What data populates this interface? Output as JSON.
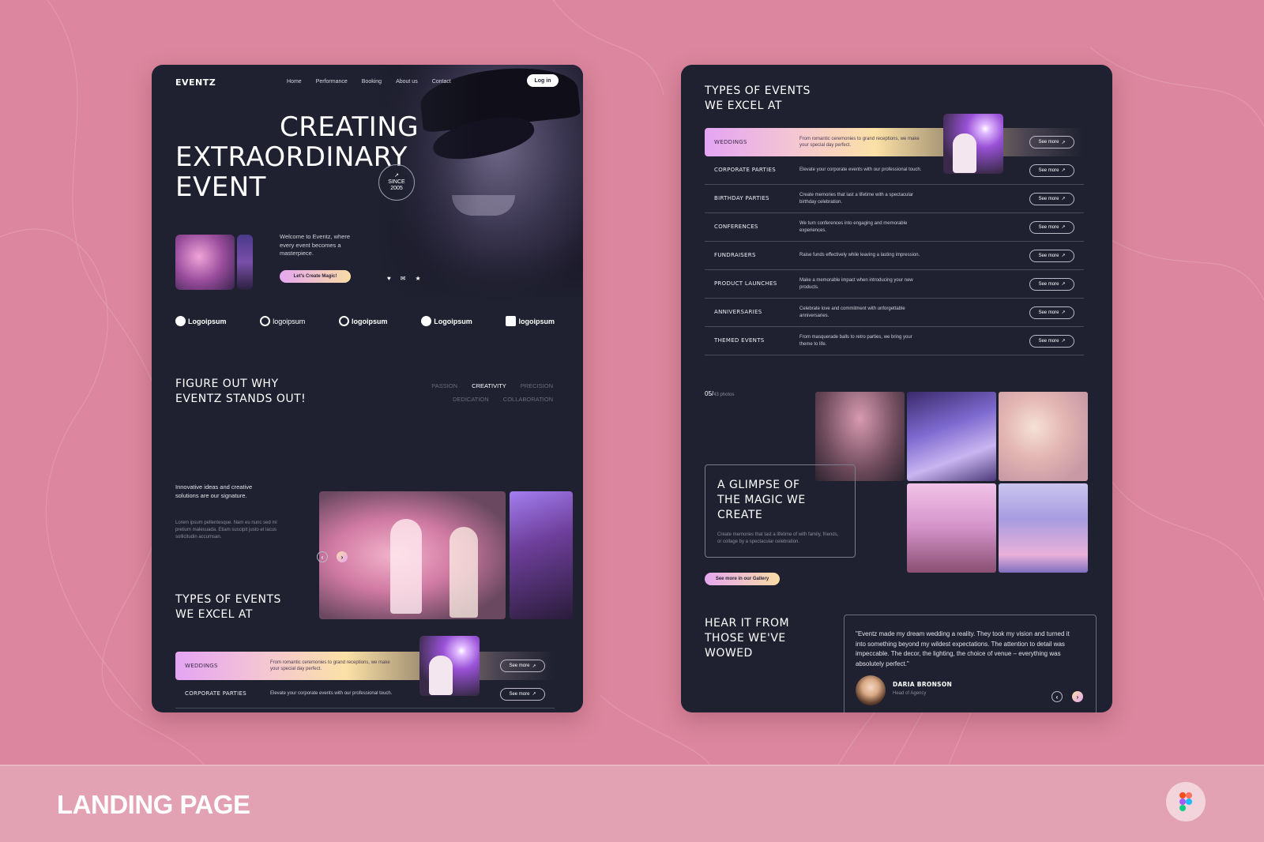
{
  "showcase": {
    "title": "LANDING PAGE",
    "tool_icon": "figma-icon",
    "background_color": "#dc879f"
  },
  "nav": {
    "logo": "EVENTZ",
    "links": [
      "Home",
      "Performance",
      "Booking",
      "About us",
      "Contact"
    ],
    "login_label": "Log in"
  },
  "hero": {
    "title_line1": "CREATING",
    "title_line2": "EXTRAORDINARY",
    "title_line3": "EVENT",
    "badge_line1": "SINCE",
    "badge_line2": "2005",
    "welcome_text": "Welcome to Eventz, where every event becomes a masterpiece.",
    "cta_label": "Let's Create Magic!",
    "social_icons": [
      "heart-icon",
      "mail-icon",
      "star-icon"
    ]
  },
  "partners": [
    "Logoipsum",
    "logoipsum",
    "logoipsum",
    "Logoipsum",
    "logoipsum"
  ],
  "why": {
    "title_line1": "FIGURE OUT WHY",
    "title_line2": "EVENTZ STANDS OUT!",
    "values_row1": [
      "PASSION",
      "CREATIVITY",
      "PRECISION"
    ],
    "values_row2": [
      "DEDICATION",
      "COLLABORATION"
    ],
    "active_value": "CREATIVITY",
    "lead": "Innovative ideas and creative solutions are our signature.",
    "body": "Lorem ipsum pellentesque. Nam eu nunc sed mi pretium malesuada. Etiam suscipit justo et lacus sollicitudin accumsan.",
    "prev_label": "‹",
    "next_label": "›"
  },
  "types": {
    "title_line1": "TYPES OF EVENTS",
    "title_line2": "WE EXCEL AT",
    "see_more_label": "See more",
    "see_more_icon": "↗",
    "events": [
      {
        "name": "WEDDINGS",
        "desc": "From romantic ceremonies to grand receptions, we make your special day perfect.",
        "featured": true
      },
      {
        "name": "CORPORATE PARTIES",
        "desc": "Elevate your corporate events with our professional touch."
      },
      {
        "name": "BIRTHDAY PARTIES",
        "desc": "Create memories that last a lifetime with a spectacular birthday celebration."
      },
      {
        "name": "CONFERENCES",
        "desc": "We turn conferences into engaging and memorable experiences."
      },
      {
        "name": "FUNDRAISERS",
        "desc": "Raise funds effectively while leaving a lasting impression."
      },
      {
        "name": "PRODUCT LAUNCHES",
        "desc": "Make a memorable impact when introducing your new products."
      },
      {
        "name": "ANNIVERSARIES",
        "desc": "Celebrate love and commitment with unforgettable anniversaries."
      },
      {
        "name": "THEMED EVENTS",
        "desc": "From masquerade balls to retro parties, we bring your theme to life."
      }
    ]
  },
  "gallery": {
    "counter_current": "05/",
    "counter_total": "43 photos",
    "title_line1": "A GLIMPSE OF",
    "title_line2": "THE MAGIC WE",
    "title_line3": "CREATE",
    "body": "Create memories that last a lifetime of with family, friends, or collage by a spectacular celebration.",
    "cta_label": "See more in our Gallery"
  },
  "testimonials": {
    "title_line1": "HEAR IT FROM",
    "title_line2": "THOSE WE'VE",
    "title_line3": "WOWED",
    "quote": "\"Eventz made my dream wedding a reality. They took my vision and turned it into something beyond my wildest expectations. The attention to detail was impeccable. The decor, the lighting, the choice of venue – everything was absolutely perfect.\"",
    "author_name": "DARIA BRONSON",
    "author_role": "Head of Agency",
    "prev_label": "‹",
    "next_label": "›"
  }
}
